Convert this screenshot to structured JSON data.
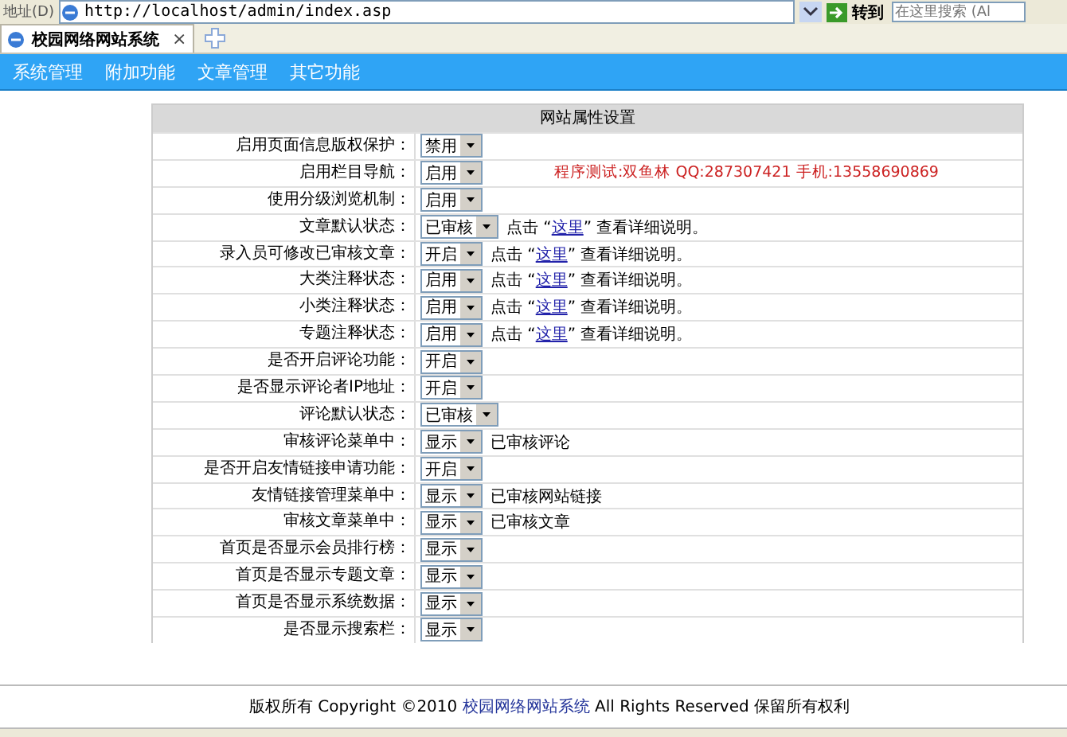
{
  "address_bar": {
    "label": "地址(D)",
    "url": "http://localhost/admin/index.asp",
    "go_button": "转到",
    "search_placeholder": "在这里搜索 (Al"
  },
  "browser_tab": {
    "title": "校园网络网站系统",
    "close": "×"
  },
  "menu": [
    {
      "label": "系统管理"
    },
    {
      "label": "附加功能"
    },
    {
      "label": "文章管理"
    },
    {
      "label": "其它功能"
    }
  ],
  "panel": {
    "title": "网站属性设置",
    "rows": [
      {
        "label": "启用页面信息版权保护：",
        "value": "禁用"
      },
      {
        "label": "启用栏目导航：",
        "value": "启用",
        "credit": "程序测试:双鱼林 QQ:287307421 手机:13558690869"
      },
      {
        "label": "使用分级浏览机制：",
        "value": "启用"
      },
      {
        "label": "文章默认状态：",
        "value": "已审核",
        "help": {
          "prefix": "点击 “",
          "link": "这里",
          "suffix": "” 查看详细说明。"
        }
      },
      {
        "label": "录入员可修改已审核文章：",
        "value": "开启",
        "help": {
          "prefix": "点击 “",
          "link": "这里",
          "suffix": "” 查看详细说明。"
        }
      },
      {
        "label": "大类注释状态：",
        "value": "启用",
        "help": {
          "prefix": "点击 “",
          "link": "这里",
          "suffix": "” 查看详细说明。"
        }
      },
      {
        "label": "小类注释状态：",
        "value": "启用",
        "help": {
          "prefix": "点击 “",
          "link": "这里",
          "suffix": "” 查看详细说明。"
        }
      },
      {
        "label": "专题注释状态：",
        "value": "启用",
        "help": {
          "prefix": "点击 “",
          "link": "这里",
          "suffix": "” 查看详细说明。"
        }
      },
      {
        "label": "是否开启评论功能：",
        "value": "开启"
      },
      {
        "label": "是否显示评论者IP地址：",
        "value": "开启"
      },
      {
        "label": "评论默认状态：",
        "value": "已审核"
      },
      {
        "label": "审核评论菜单中：",
        "value": "显示",
        "note": "已审核评论"
      },
      {
        "label": "是否开启友情链接申请功能：",
        "value": "开启"
      },
      {
        "label": "友情链接管理菜单中：",
        "value": "显示",
        "note": "已审核网站链接"
      },
      {
        "label": "审核文章菜单中：",
        "value": "显示",
        "note": "已审核文章"
      },
      {
        "label": "首页是否显示会员排行榜：",
        "value": "显示"
      },
      {
        "label": "首页是否显示专题文章：",
        "value": "显示"
      },
      {
        "label": "首页是否显示系统数据：",
        "value": "显示"
      },
      {
        "label": "是否显示搜索栏：",
        "value": "显示"
      }
    ]
  },
  "footer": {
    "prefix": "版权所有 Copyright ©2010 ",
    "link": "校园网络网站系统",
    "suffix": " All Rights Reserved 保留所有权利"
  }
}
